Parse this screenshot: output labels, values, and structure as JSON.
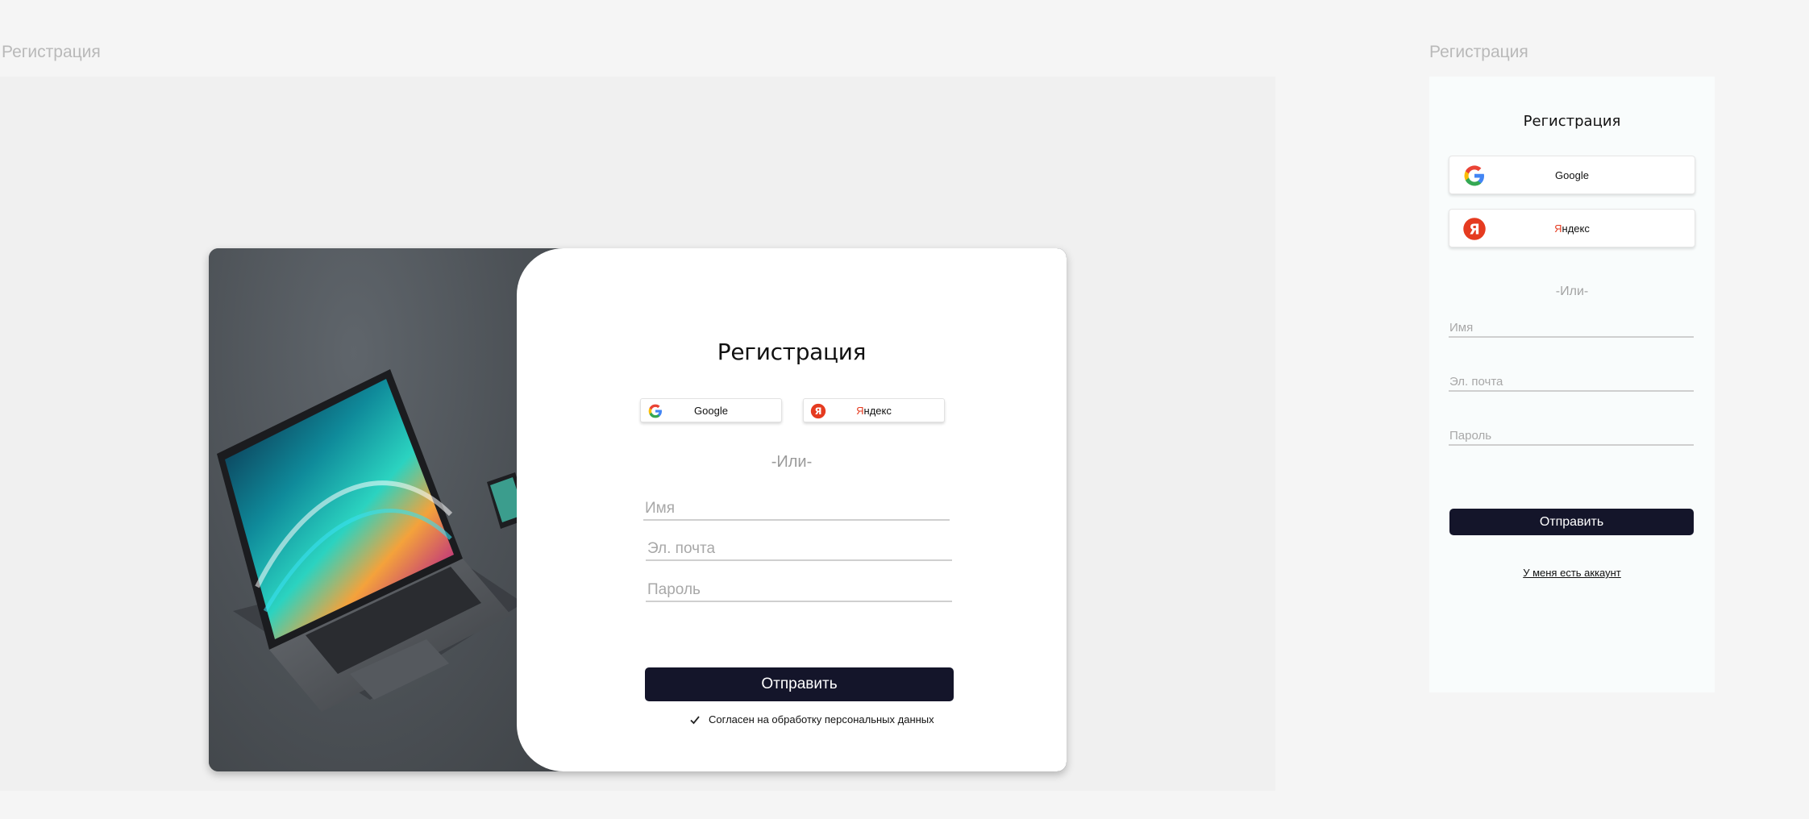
{
  "desktop": {
    "frame_label": "Регистрация",
    "title": "Регистрация",
    "google_label": "Google",
    "yandex_label_first": "Я",
    "yandex_label_rest": "ндекс",
    "or_text": "-Или-",
    "name_placeholder": "Имя",
    "email_placeholder": "Эл. почта",
    "password_placeholder": "Пароль",
    "submit_label": "Отправить",
    "consent_text": "Согласен на обработку персональных данных"
  },
  "mobile": {
    "frame_label": "Регистрация",
    "title": "Регистрация",
    "google_label": "Google",
    "yandex_label_first": "Я",
    "yandex_label_rest": "ндекс",
    "or_text": "-Или-",
    "name_placeholder": "Имя",
    "email_placeholder": "Эл. почта",
    "password_placeholder": "Пароль",
    "submit_label": "Отправить",
    "login_link": "У меня есть аккаунт"
  },
  "icons": {
    "google": "google-logo-icon",
    "yandex": "yandex-logo-icon",
    "check": "check-icon"
  },
  "colors": {
    "button_bg": "#14152a",
    "yandex_red": "#e53b20",
    "page_bg": "#f5f5f5"
  }
}
